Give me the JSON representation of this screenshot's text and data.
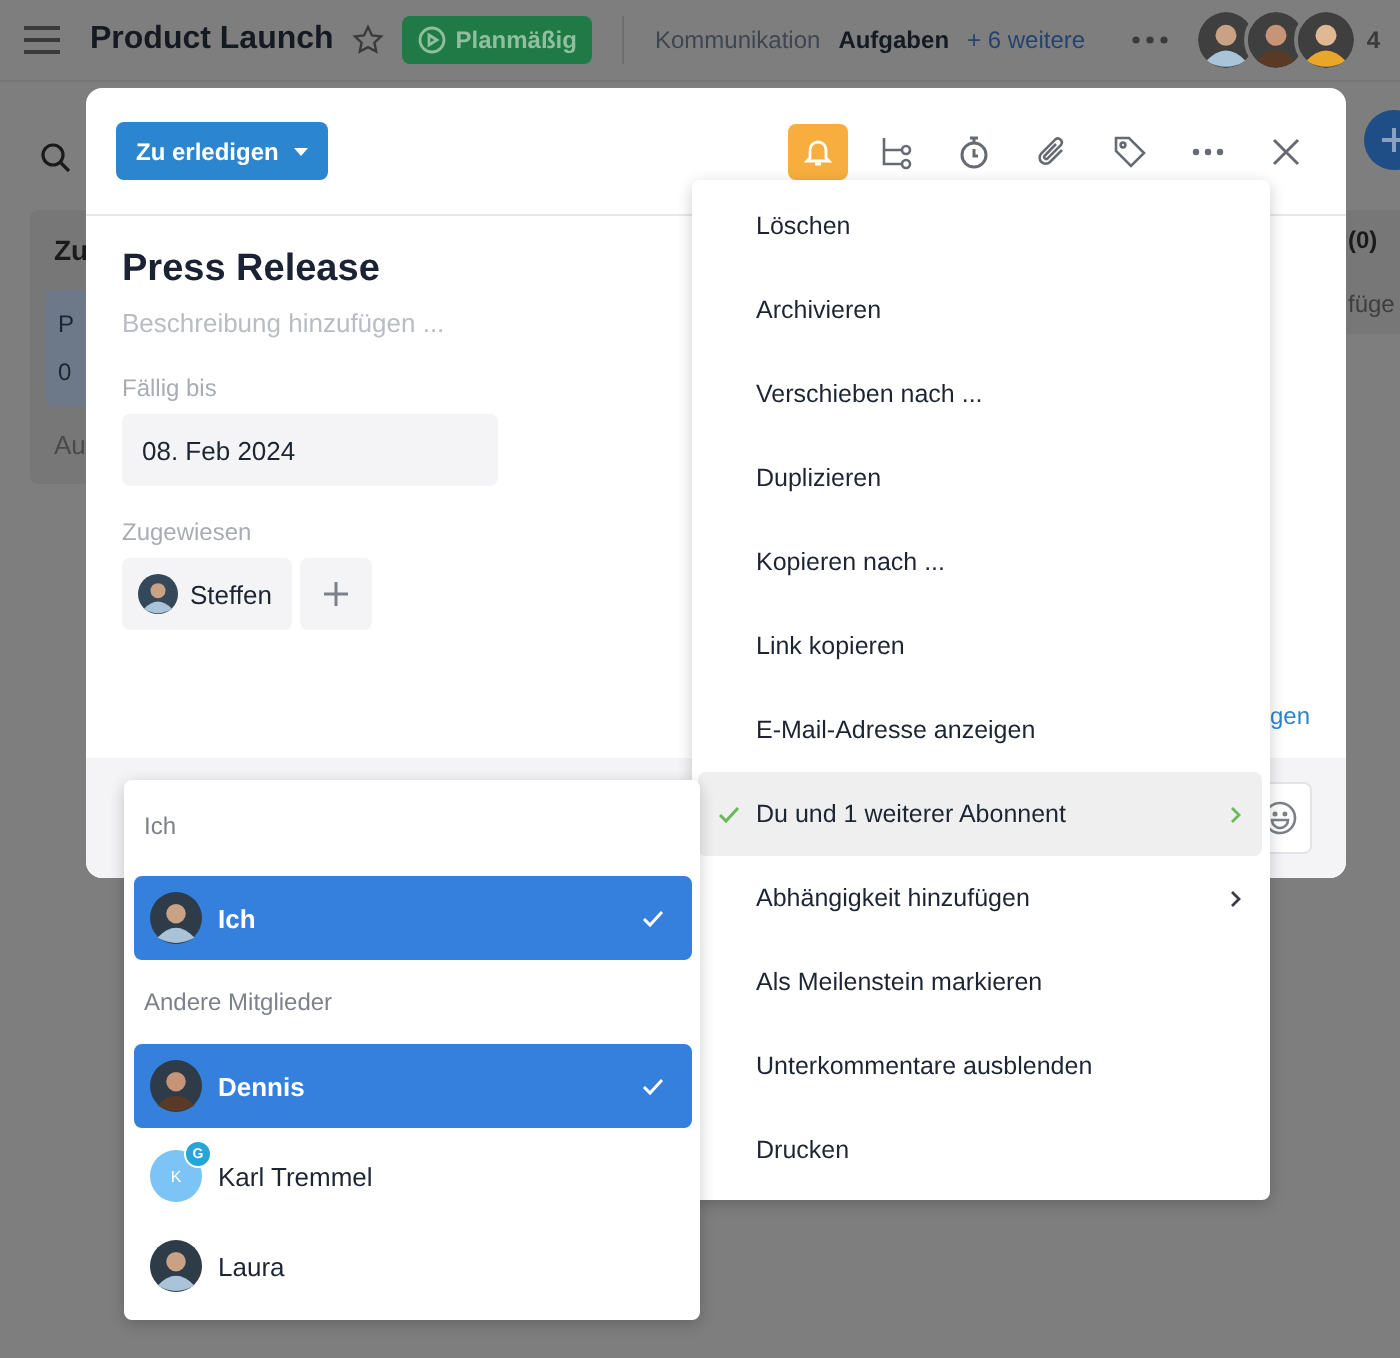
{
  "top_bar": {
    "title": "Product Launch",
    "status": "Planmäßig",
    "tabs": [
      {
        "label": "Kommunikation",
        "selected": false
      },
      {
        "label": "Aufgaben",
        "selected": true
      }
    ],
    "more_tabs": "+ 6 weitere",
    "member_count": "4"
  },
  "board_background": {
    "left_column": {
      "title": "Zu",
      "card_title": "P",
      "card_date": "0",
      "add_label": "Au"
    },
    "right_column": {
      "count": "(0)",
      "add_label": "füge"
    }
  },
  "task": {
    "status": "Zu erledigen",
    "reminder_on": true,
    "title": "Press Release",
    "description_placeholder": "Beschreibung hinzufügen ...",
    "due_label": "Fällig bis",
    "due_date": "08. Feb 2024",
    "assigned_label": "Zugewiesen",
    "assignees": [
      {
        "name": "Steffen"
      }
    ],
    "link_fragment": "gen"
  },
  "more_menu": {
    "items": [
      {
        "label": "Löschen",
        "checked": false,
        "submenu": false,
        "selected": false
      },
      {
        "label": "Archivieren",
        "checked": false,
        "submenu": false,
        "selected": false
      },
      {
        "label": "Verschieben nach ...",
        "checked": false,
        "submenu": false,
        "selected": false
      },
      {
        "label": "Duplizieren",
        "checked": false,
        "submenu": false,
        "selected": false
      },
      {
        "label": "Kopieren nach ...",
        "checked": false,
        "submenu": false,
        "selected": false
      },
      {
        "label": "Link kopieren",
        "checked": false,
        "submenu": false,
        "selected": false
      },
      {
        "label": "E-Mail-Adresse anzeigen",
        "checked": false,
        "submenu": false,
        "selected": false
      },
      {
        "label": "Du und 1 weiterer Abonnent",
        "checked": true,
        "submenu": true,
        "selected": true
      },
      {
        "label": "Abhängigkeit hinzufügen",
        "checked": false,
        "submenu": true,
        "selected": false
      },
      {
        "label": "Als Meilenstein markieren",
        "checked": false,
        "submenu": false,
        "selected": false
      },
      {
        "label": "Unterkommentare ausblenden",
        "checked": false,
        "submenu": false,
        "selected": false
      },
      {
        "label": "Drucken",
        "checked": false,
        "submenu": false,
        "selected": false
      }
    ]
  },
  "assignee_picker": {
    "sections": [
      {
        "title": "Ich",
        "members": [
          {
            "name": "Ich",
            "selected": true,
            "kind": "photo"
          }
        ]
      },
      {
        "title": "Andere Mitglieder",
        "members": [
          {
            "name": "Dennis",
            "selected": true,
            "kind": "photo"
          },
          {
            "name": "Karl Tremmel",
            "selected": false,
            "kind": "initial",
            "initial": "K",
            "badge": "G"
          },
          {
            "name": "Laura",
            "selected": false,
            "kind": "photo"
          }
        ]
      }
    ]
  }
}
